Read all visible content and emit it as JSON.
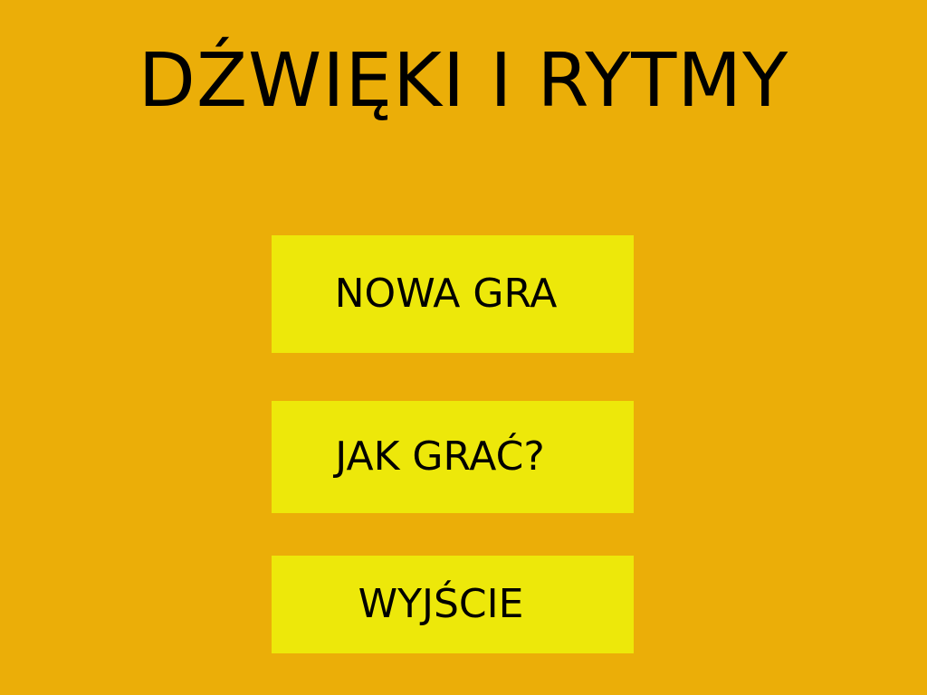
{
  "title": "DŹWIĘKI I RYTMY",
  "menu": {
    "new_game": "NOWA GRA",
    "how_to_play": "JAK GRAĆ?",
    "exit": "WYJŚCIE"
  },
  "colors": {
    "background": "#EBAE08",
    "button": "#EDE80A",
    "text": "#000000"
  }
}
